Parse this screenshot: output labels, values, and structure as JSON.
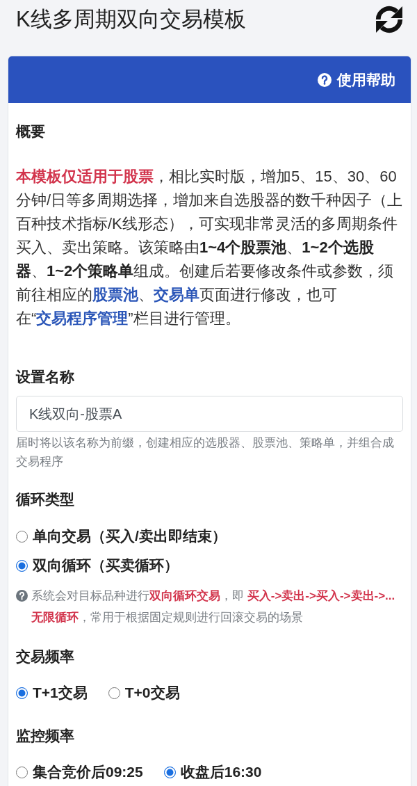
{
  "header": {
    "title": "K线多周期双向交易模板"
  },
  "panel": {
    "help_button": "使用帮助"
  },
  "overview": {
    "heading": "概要",
    "paragraph": [
      {
        "kind": "alert",
        "text": "本模板仅适用于股票"
      },
      {
        "kind": "plain",
        "text": "，相比实时版，增加5、15、30、60分钟/日等多周期选择，增加来自选股器的数千种因子（上百种技术指标/K线形态），可实现非常灵活的多周期条件买入、卖出策略。该策略由"
      },
      {
        "kind": "bold",
        "text": "1~4个股票池"
      },
      {
        "kind": "plain",
        "text": "、"
      },
      {
        "kind": "bold",
        "text": "1~2个选股器"
      },
      {
        "kind": "plain",
        "text": "、"
      },
      {
        "kind": "bold",
        "text": "1~2个策略单"
      },
      {
        "kind": "plain",
        "text": "组成。创建后若要修改条件或参数，须前往相应的"
      },
      {
        "kind": "link",
        "text": "股票池"
      },
      {
        "kind": "plain",
        "text": "、"
      },
      {
        "kind": "link",
        "text": "交易单"
      },
      {
        "kind": "plain",
        "text": "页面进行修改，也可在“"
      },
      {
        "kind": "link",
        "text": "交易程序管理"
      },
      {
        "kind": "plain",
        "text": "”栏目进行管理。"
      }
    ]
  },
  "settings": [
    {
      "kind": "text_field",
      "label": "设置名称",
      "value": "K线双向-股票A",
      "help": "届时将以该名称为前缀，创建相应的选股器、股票池、策略单，并组合成交易程序"
    },
    {
      "kind": "radio_stacked",
      "label": "循环类型",
      "options": [
        {
          "label": "单向交易（买入/卖出即结束）",
          "selected": false
        },
        {
          "label": "双向循环（买卖循环）",
          "selected": true
        }
      ],
      "note": [
        {
          "kind": "plain",
          "text": "系统会对目标品种进行"
        },
        {
          "kind": "alert",
          "text": "双向循环交易"
        },
        {
          "kind": "plain",
          "text": "，即 "
        },
        {
          "kind": "alert",
          "text": "买入->卖出->买入->卖出->... 无限循环"
        },
        {
          "kind": "plain",
          "text": "，常用于根据固定规则进行回滚交易的场景"
        }
      ]
    },
    {
      "kind": "radio_inline",
      "label": "交易频率",
      "options": [
        {
          "label": "T+1交易",
          "selected": true
        },
        {
          "label": "T+0交易",
          "selected": false
        }
      ]
    },
    {
      "kind": "radio_inline",
      "label": "监控频率",
      "options": [
        {
          "label": "集合竞价后09:25",
          "selected": false
        },
        {
          "label": "收盘后16:30",
          "selected": true
        }
      ]
    }
  ]
}
